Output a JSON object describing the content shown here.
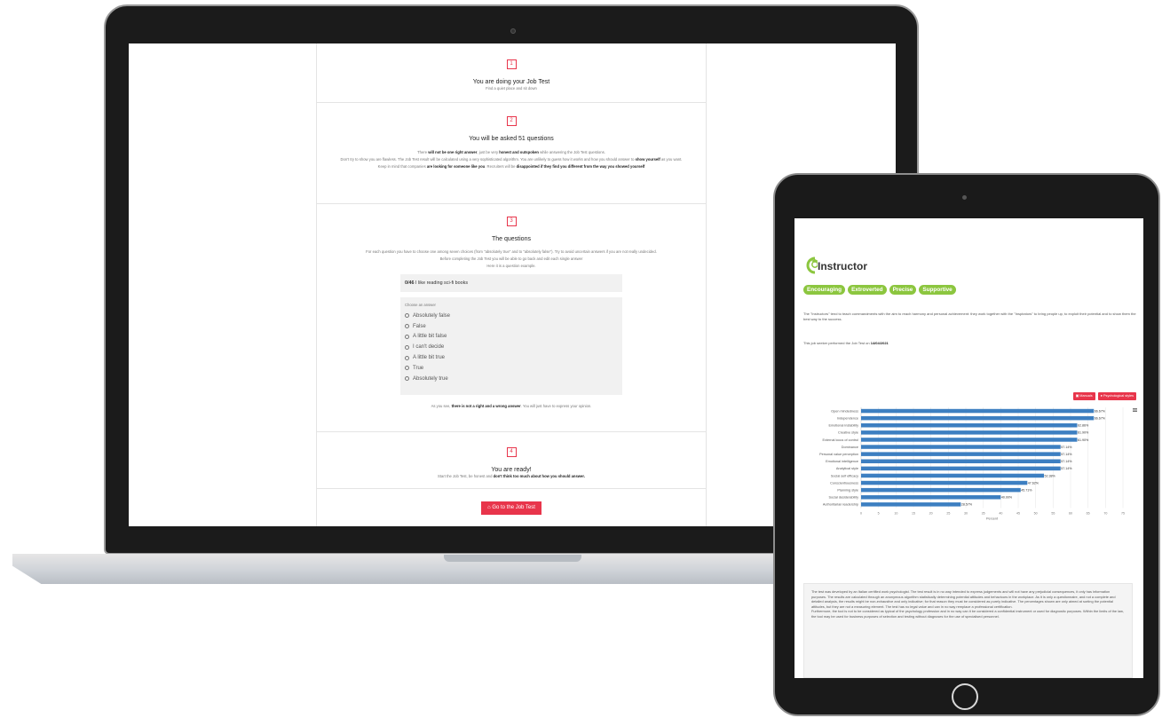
{
  "laptop": {
    "steps": [
      {
        "num": "1",
        "title": "You are doing your Job Test",
        "subtitle": "Find a quiet place and sit down"
      },
      {
        "num": "2",
        "title": "You will be asked 51 questions",
        "line1_pre": "There ",
        "line1_b1": "will not be one right answer",
        "line1_mid": ", just be very ",
        "line1_b2": "honest and outspoken",
        "line1_post": " while answering the Job Test questions.",
        "line2_pre": "Don't try to show you are flawless. The Job Test result will be calculated using a very sophisticated algorithm. You are unlikely to guess how it works and how you should answer to ",
        "line2_b": "show yourself",
        "line2_post": " as you want.",
        "line3_pre": "Keep in mind that companies ",
        "line3_b1": "are looking for someone like you",
        "line3_mid": ". Recruiters will be ",
        "line3_b2": "disappointed if they find you different from the way you showed yourself"
      },
      {
        "num": "3",
        "title": "The questions",
        "line1": "For each question you have to choose one among seven choices (from \"absolutely true\" and to \"absolutely false\"). Try to avoid uncertain answers if you are not really undecided.",
        "line2": "Before completing the Job Test you will be able to go back and edit each single answer",
        "line3": "Here it is a question example.",
        "question_counter": "0/46",
        "question_text": "I like reading sci-fi books",
        "choose_label": "Choose an answer",
        "options": [
          "Absolutely false",
          "False",
          "A little bit false",
          "I can't decide",
          "A little bit true",
          "True",
          "Absolutely true"
        ],
        "footer_pre": "As you see, ",
        "footer_b": "there is not a right and a wrong answer",
        "footer_post": ". You will just have to express your opinion."
      },
      {
        "num": "4",
        "title": "You are ready!",
        "sub_pre": "Start the Job Test, be honest and ",
        "sub_b": "don't think too much about how you should answer."
      }
    ],
    "cta_label": "Go to the Job Test"
  },
  "tablet": {
    "profile_title": "Instructor",
    "tags": [
      "Encouraging",
      "Extroverted",
      "Precise",
      "Supportive"
    ],
    "description": "The \"Instructors\" tend to teach commandments with the aim to reach harmony and personal achievement: they work together with the \"Inspirators\" to bring people up, to exploit their potential and to show them the best way to the success.",
    "date_pre": "This job seeker performed the Job Test on ",
    "date": "14/04/2021",
    "btn_manuals": "Manuals",
    "btn_psych": "Psychological styles",
    "disclaimer": "The test was developed by an Italian certified work psychologist. The test result is in no way intended to express judgements and will not have any prejudicial consequences, it only has information purposes. The results are calculated through an anonymous algorithm statistically determining potential attitudes and behaviours in the workplace. As it is only a questionnaire, and not a complete and detailed analysis, the results might be non-exhaustive and only indicative; for that reason they must be considered as purely indicative. The percentages shown are only aimed at sorting the potential attitudes, but they are not a measuring element. The test has no legal value and can in no way remplace a professional certification.\nFurthermore, the tool is not to be considered as typical of the psychology profession and in no way can it be considered a confidential instrument or used for diagnostic purposes. Within the limits of the law, the tool may be used for business purposes of selection and testing without diagnoses for the use of specialised personnel."
  },
  "chart_data": {
    "type": "bar",
    "orientation": "horizontal",
    "categories": [
      "Open mindedness",
      "Independence",
      "Emotional instability",
      "Creative style",
      "External locus of control",
      "Dominance",
      "Personal value perception",
      "Emotional intelligence",
      "Analytical style",
      "Social self efficacy",
      "Conscientiousness",
      "Planning style",
      "Social desiderability",
      "Authoritarian leadership"
    ],
    "values": [
      66.67,
      66.67,
      61.9,
      61.9,
      61.9,
      57.14,
      57.14,
      57.14,
      57.14,
      52.38,
      47.62,
      45.71,
      40.0,
      28.57
    ],
    "value_labels": [
      "66.67%",
      "66.67%",
      "62.86%",
      "61.90%",
      "61.90%",
      "57.14%",
      "57.14%",
      "57.14%",
      "57.14%",
      "52.38%",
      "47.62%",
      "45.71%",
      "40.00%",
      "28.57%"
    ],
    "xlim": [
      0,
      75
    ],
    "xticks": [
      "0",
      "5",
      "10",
      "15",
      "20",
      "25",
      "30",
      "35",
      "40",
      "45",
      "50",
      "55",
      "60",
      "65",
      "70",
      "75"
    ],
    "xlabel": "Percent",
    "color": "#3d7fc1"
  },
  "colors": {
    "accent": "#e8354b",
    "tag": "#8cc63f",
    "bar": "#3d7fc1"
  }
}
